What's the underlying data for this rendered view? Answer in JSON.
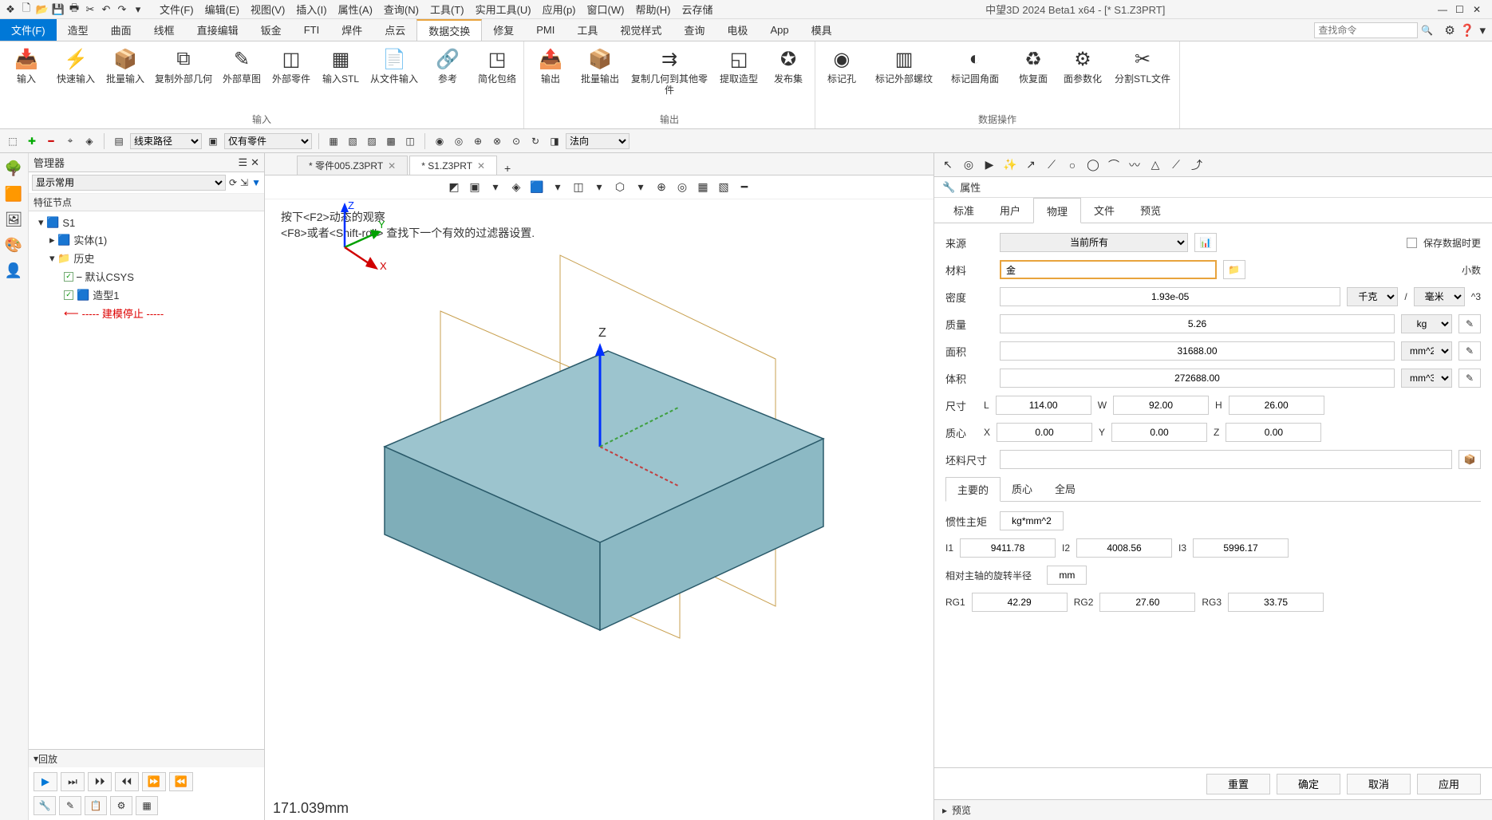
{
  "titlebar": {
    "menus": [
      "文件(F)",
      "编辑(E)",
      "视图(V)",
      "插入(I)",
      "属性(A)",
      "查询(N)",
      "工具(T)",
      "实用工具(U)",
      "应用(p)",
      "窗口(W)",
      "帮助(H)",
      "云存储"
    ],
    "title": "中望3D 2024 Beta1 x64 - [* S1.Z3PRT]"
  },
  "ribbonTabs": {
    "file": "文件(F)",
    "tabs": [
      "造型",
      "曲面",
      "线框",
      "直接编辑",
      "钣金",
      "FTI",
      "焊件",
      "点云",
      "数据交换",
      "修复",
      "PMI",
      "工具",
      "视觉样式",
      "查询",
      "电极",
      "App",
      "模具"
    ],
    "active": "数据交换",
    "searchPlaceholder": "查找命令"
  },
  "ribbon": {
    "g1": {
      "name": "输入",
      "items": [
        "输入",
        "快速输入",
        "批量输入",
        "复制外部几何",
        "外部草图",
        "外部零件",
        "输入STL",
        "从文件输入",
        "参考",
        "简化包络"
      ]
    },
    "g2": {
      "name": "输出",
      "items": [
        "输出",
        "批量输出",
        "复制几何到其他零件",
        "提取造型",
        "发布集"
      ]
    },
    "g3": {
      "name": "数据操作",
      "items": [
        "标记孔",
        "标记外部螺纹",
        "标记圆角面",
        "恢复面",
        "面参数化",
        "分割STL文件"
      ]
    }
  },
  "toolbar2": {
    "combo1": "线束路径",
    "combo2": "仅有零件",
    "combo3": "法向"
  },
  "manager": {
    "title": "管理器",
    "filterLabel": "显示常用",
    "subheader": "特征节点",
    "tree": {
      "root": "S1",
      "n1": "实体(1)",
      "n2": "历史",
      "n3": "默认CSYS",
      "n4": "造型1",
      "stop": "----- 建模停止 -----"
    },
    "playback": "回放"
  },
  "doctabs": {
    "tab1": "* 零件005.Z3PRT",
    "tab2": "* S1.Z3PRT"
  },
  "viewport": {
    "hint1": "按下<F2>动态的观察",
    "hint2": "<F8>或者<Shift-roll> 查找下一个有效的过滤器设置.",
    "status": "171.039mm"
  },
  "props": {
    "title": "属性",
    "tabs": [
      "标准",
      "用户",
      "物理",
      "文件",
      "预览"
    ],
    "activeTab": "物理",
    "source": {
      "label": "来源",
      "value": "当前所有",
      "save": "保存数据时更"
    },
    "material": {
      "label": "材料",
      "value": "金",
      "side": "小数"
    },
    "density": {
      "label": "密度",
      "value": "1.93e-05",
      "unit1": "千克",
      "unit2": "毫米",
      "exp": "^3"
    },
    "mass": {
      "label": "质量",
      "value": "5.26",
      "unit": "kg"
    },
    "area": {
      "label": "面积",
      "value": "31688.00",
      "unit": "mm^2"
    },
    "volume": {
      "label": "体积",
      "value": "272688.00",
      "unit": "mm^3"
    },
    "size": {
      "label": "尺寸",
      "L": "L",
      "Lv": "114.00",
      "W": "W",
      "Wv": "92.00",
      "H": "H",
      "Hv": "26.00"
    },
    "centroid": {
      "label": "质心",
      "X": "X",
      "Xv": "0.00",
      "Y": "Y",
      "Yv": "0.00",
      "Z": "Z",
      "Zv": "0.00"
    },
    "blank": {
      "label": "坯料尺寸"
    },
    "subtabs": [
      "主要的",
      "质心",
      "全局"
    ],
    "inertia": {
      "label": "惯性主矩",
      "unit": "kg*mm^2"
    },
    "I": {
      "I1": "I1",
      "I1v": "9411.78",
      "I2": "I2",
      "I2v": "4008.56",
      "I3": "I3",
      "I3v": "5996.17"
    },
    "radius": {
      "label": "相对主轴的旋转半径",
      "unit": "mm"
    },
    "RG": {
      "R1": "RG1",
      "R1v": "42.29",
      "R2": "RG2",
      "R2v": "27.60",
      "R3": "RG3",
      "R3v": "33.75"
    },
    "buttons": {
      "reset": "重置",
      "ok": "确定",
      "cancel": "取消",
      "apply": "应用"
    },
    "preview": "预览"
  }
}
